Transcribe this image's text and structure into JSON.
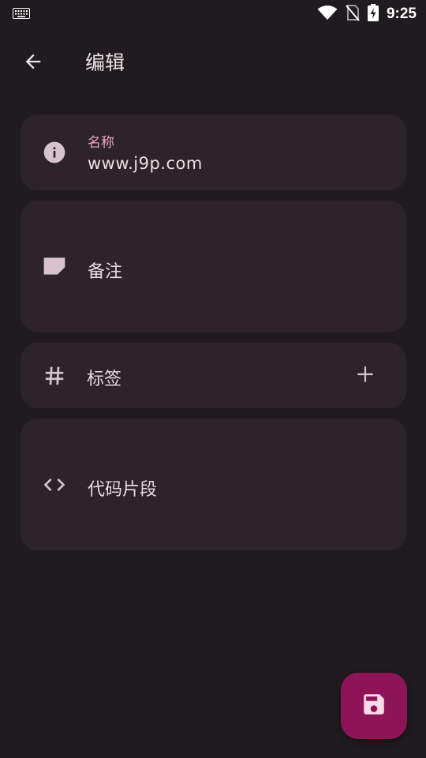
{
  "status_bar": {
    "time": "9:25",
    "icons": [
      "keyboard-icon",
      "wifi-icon",
      "no-sim-icon",
      "battery-charging-icon"
    ]
  },
  "app_bar": {
    "title": "编辑",
    "back_icon": "arrow-back-icon"
  },
  "fields": {
    "name": {
      "label": "名称",
      "value": "www.j9p.com",
      "icon": "info-icon"
    },
    "note": {
      "placeholder": "备注",
      "icon": "note-icon"
    },
    "tags": {
      "label": "标签",
      "icon": "hash-icon",
      "add_icon": "plus-icon"
    },
    "code": {
      "placeholder": "代码片段",
      "icon": "code-icon"
    }
  },
  "fab": {
    "icon": "save-icon"
  },
  "colors": {
    "background": "#201b1e",
    "card": "#2c2428",
    "accent_label": "#f0a5c6",
    "fab": "#8c1457",
    "icon": "#d8c3cc"
  }
}
